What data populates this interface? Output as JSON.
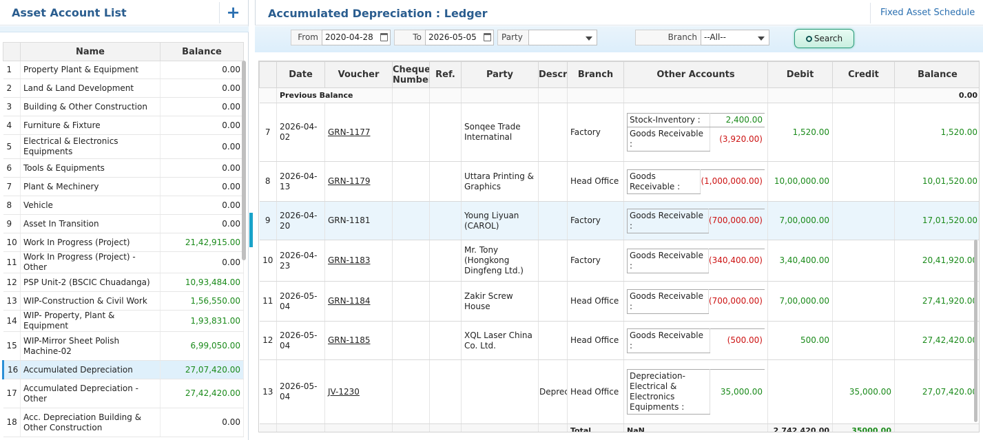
{
  "left": {
    "title": "Asset Account List",
    "add_icon": "+",
    "headers": [
      "Name",
      "Balance"
    ],
    "rows": [
      {
        "no": "1",
        "name": "Property Plant & Equipment",
        "balance": "0.00",
        "green": false
      },
      {
        "no": "2",
        "name": "Land & Land Development",
        "balance": "0.00",
        "green": false
      },
      {
        "no": "3",
        "name": "Building & Other Construction",
        "balance": "0.00",
        "green": false
      },
      {
        "no": "4",
        "name": "Furniture & Fixture",
        "balance": "0.00",
        "green": false
      },
      {
        "no": "5",
        "name": "Electrical & Electronics Equipments",
        "balance": "0.00",
        "green": false
      },
      {
        "no": "6",
        "name": "Tools & Equipments",
        "balance": "0.00",
        "green": false
      },
      {
        "no": "7",
        "name": "Plant & Mechinery",
        "balance": "0.00",
        "green": false
      },
      {
        "no": "8",
        "name": "Vehicle",
        "balance": "0.00",
        "green": false
      },
      {
        "no": "9",
        "name": "Asset In Transition",
        "balance": "0.00",
        "green": false
      },
      {
        "no": "10",
        "name": "Work In Progress (Project)",
        "balance": "21,42,915.00",
        "green": true
      },
      {
        "no": "11",
        "name": "Work In Progress (Project) -Other",
        "balance": "0.00",
        "green": false
      },
      {
        "no": "12",
        "name": "PSP Unit-2 (BSCIC Chuadanga)",
        "balance": "10,93,484.00",
        "green": true
      },
      {
        "no": "13",
        "name": "WIP-Construction & Civil Work",
        "balance": "1,56,550.00",
        "green": true
      },
      {
        "no": "14",
        "name": "WIP- Property, Plant & Equipment",
        "balance": "1,93,831.00",
        "green": true
      },
      {
        "no": "15",
        "name": "WIP-Mirror Sheet Polish Machine-02",
        "balance": "6,99,050.00",
        "green": true
      },
      {
        "no": "16",
        "name": "Accumulated Depreciation",
        "balance": "27,07,420.00",
        "green": true,
        "selected": true
      },
      {
        "no": "17",
        "name": "Accumulated Depreciation - Other",
        "balance": "27,42,420.00",
        "green": true
      },
      {
        "no": "18",
        "name": "Acc. Depreciation Building & Other Construction",
        "balance": "0.00",
        "green": false
      }
    ]
  },
  "right": {
    "title": "Accumulated Depreciation : Ledger",
    "fixed_asset_schedule": "Fixed Asset Schedule",
    "filter": {
      "from_label": "From",
      "from_value": "2020-04-28",
      "to_label": "To",
      "to_value": "2026-05-05",
      "party_label": "Party",
      "party_value": "",
      "branch_label": "Branch",
      "branch_value": "--All--",
      "search_label": "Search"
    },
    "headers": [
      "Date",
      "Voucher",
      "Cheque Number",
      "Ref.",
      "Party",
      "Description",
      "Branch",
      "Other Accounts",
      "Debit",
      "Credit",
      "Balance"
    ],
    "previous_balance_label": "Previous Balance",
    "previous_balance_value": "0.00",
    "rows": [
      {
        "no": "7",
        "date": "2026-04-02",
        "voucher": "GRN-1177",
        "party": "Sonqee Trade Internatinal",
        "desc": "",
        "branch": "Factory",
        "others": [
          {
            "name": "Stock-Inventory :",
            "value": "2,400.00",
            "neg": false
          },
          {
            "name": "Goods Receivable :",
            "value": "(3,920.00)",
            "neg": true
          }
        ],
        "debit": "1,520.00",
        "credit": "",
        "balance": "1,520.00"
      },
      {
        "no": "8",
        "date": "2026-04-13",
        "voucher": "GRN-1179",
        "party": "Uttara Printing & Graphics",
        "desc": "",
        "branch": "Head Office",
        "others": [
          {
            "name": "Goods Receivable :",
            "value": "(1,000,000.00)",
            "neg": true
          }
        ],
        "debit": "10,00,000.00",
        "credit": "",
        "balance": "10,01,520.00"
      },
      {
        "no": "9",
        "date": "2026-04-20",
        "voucher": "GRN-1181",
        "party": "Young Liyuan (CAROL)",
        "desc": "",
        "branch": "Factory",
        "others": [
          {
            "name": "Goods Receivable :",
            "value": "(700,000.00)",
            "neg": true
          }
        ],
        "debit": "7,00,000.00",
        "credit": "",
        "balance": "17,01,520.00",
        "highlight": true
      },
      {
        "no": "10",
        "date": "2026-04-23",
        "voucher": "GRN-1183",
        "party": "Mr. Tony (Hongkong Dingfeng Ltd.)",
        "desc": "",
        "branch": "Factory",
        "others": [
          {
            "name": "Goods Receivable :",
            "value": "(340,400.00)",
            "neg": true
          }
        ],
        "debit": "3,40,400.00",
        "credit": "",
        "balance": "20,41,920.00"
      },
      {
        "no": "11",
        "date": "2026-05-04",
        "voucher": "GRN-1184",
        "party": "Zakir Screw House",
        "desc": "",
        "branch": "Head Office",
        "others": [
          {
            "name": "Goods Receivable :",
            "value": "(700,000.00)",
            "neg": true
          }
        ],
        "debit": "7,00,000.00",
        "credit": "",
        "balance": "27,41,920.00"
      },
      {
        "no": "12",
        "date": "2026-05-04",
        "voucher": "GRN-1185",
        "party": "XQL Laser China Co. Ltd.",
        "desc": "",
        "branch": "Head Office",
        "others": [
          {
            "name": "Goods Receivable :",
            "value": "(500.00)",
            "neg": true
          }
        ],
        "debit": "500.00",
        "credit": "",
        "balance": "27,42,420.00"
      },
      {
        "no": "13",
        "date": "2026-05-04",
        "voucher": "JV-1230",
        "party": "",
        "desc": "Depreciation",
        "branch": "Head Office",
        "others": [
          {
            "name": "Depreciation-Electrical & Electronics Equipments :",
            "value": "35,000.00",
            "neg": false
          }
        ],
        "debit": "",
        "credit": "35,000.00",
        "balance": "27,07,420.00"
      }
    ],
    "total": {
      "label": "Total",
      "others": "NaN",
      "debit": "2,742,420.00",
      "credit": "35000.00"
    }
  }
}
